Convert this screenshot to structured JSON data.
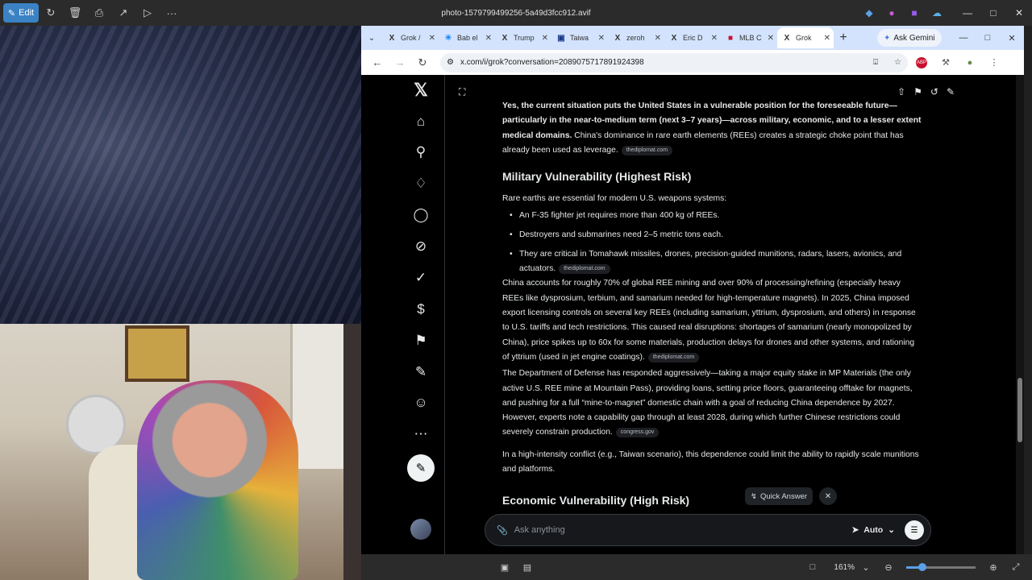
{
  "viewer": {
    "edit_label": "Edit",
    "title": "photo-1579799499256-5a49d3fcc912.avif",
    "zoom_percent": "161%",
    "zoom_level": 0.23
  },
  "browser": {
    "tabs": [
      {
        "label": "Grok /",
        "favicon": "X",
        "active": false
      },
      {
        "label": "Bab el",
        "favicon": "☀",
        "active": false
      },
      {
        "label": "Trump",
        "favicon": "X",
        "active": false
      },
      {
        "label": "Taiwa",
        "favicon": "▣",
        "active": false
      },
      {
        "label": "zeroh",
        "favicon": "X",
        "active": false
      },
      {
        "label": "Eric D",
        "favicon": "X",
        "active": false
      },
      {
        "label": "MLB C",
        "favicon": "■",
        "active": false
      },
      {
        "label": "Grok",
        "favicon": "X",
        "active": true
      }
    ],
    "gemini_label": "Ask Gemini",
    "url": "x.com/i/grok?conversation=2089075717891924398"
  },
  "grok": {
    "intro_bold": "Yes, the current situation puts the United States in a vulnerable position for the foreseeable future—particularly in the near-to-medium term (next 3–7 years)—across military, economic, and to a lesser extent medical domains.",
    "intro_rest": " China's dominance in rare earth elements (REEs) creates a strategic choke point that has already been used as leverage.",
    "cite_1": "thediplomat.com",
    "heading_military": "Military Vulnerability (Highest Risk)",
    "rare_earths_intro": "Rare earths are essential for modern U.S. weapons systems:",
    "bullets": [
      "An F-35 fighter jet requires more than 400 kg of REEs.",
      "Destroyers and submarines need 2–5 metric tons each.",
      "They are critical in Tomahawk missiles, drones, precision-guided munitions, radars, lasers, avionics, and actuators."
    ],
    "cite_2": "thediplomat.com",
    "china_para": "China accounts for roughly 70% of global REE mining and over 90% of processing/refining (especially heavy REEs like dysprosium, terbium, and samarium needed for high-temperature magnets). In 2025, China imposed export licensing controls on several key REEs (including samarium, yttrium, dysprosium, and others) in response to U.S. tariffs and tech restrictions. This caused real disruptions: shortages of samarium (nearly monopolized by China), price spikes up to 60x for some materials, production delays for drones and other systems, and rationing of yttrium (used in jet engine coatings).",
    "cite_3": "thediplomat.com",
    "dod_para": "The Department of Defense has responded aggressively—taking a major equity stake in MP Materials (the only active U.S. REE mine at Mountain Pass), providing loans, setting price floors, guaranteeing offtake for magnets, and pushing for a full “mine-to-magnet” domestic chain with a goal of reducing China dependence by 2027. However, experts note a capability gap through at least 2028, during which further Chinese restrictions could severely constrain production.",
    "cite_4": "congress.gov",
    "conflict_para": "In a high-intensity conflict (e.g., Taiwan scenario), this dependence could limit the ability to rapidly scale munitions and platforms.",
    "heading_economic": "Economic Vulnerability (High Risk)",
    "quick_answer": "Quick Answer",
    "input_placeholder": "Ask anything",
    "mode_label": "Auto"
  }
}
